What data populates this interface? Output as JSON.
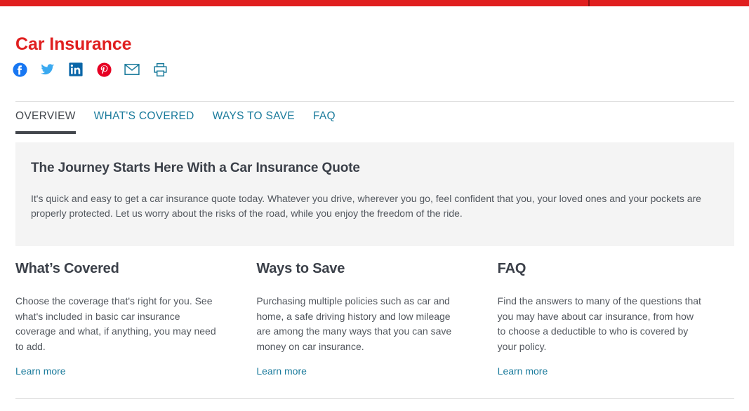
{
  "topbar": {
    "color": "#e01f1f",
    "divider_color": "#8c1212"
  },
  "header": {
    "title": "Car Insurance",
    "title_color": "#e01f1f"
  },
  "share": {
    "items": [
      {
        "name": "facebook-icon",
        "label": "Facebook",
        "color": "#1877f2"
      },
      {
        "name": "twitter-icon",
        "label": "Twitter",
        "color": "#3aa9f0"
      },
      {
        "name": "linkedin-icon",
        "label": "LinkedIn",
        "color": "#0a66a8"
      },
      {
        "name": "pinterest-icon",
        "label": "Pinterest",
        "color": "#e60023"
      },
      {
        "name": "email-icon",
        "label": "Email",
        "color": "#1b7b9c"
      },
      {
        "name": "print-icon",
        "label": "Print",
        "color": "#1b7b9c"
      }
    ]
  },
  "tabs": {
    "active_index": 0,
    "active_color": "#43474d",
    "link_color": "#1b7b9c",
    "items": [
      {
        "label": "OVERVIEW"
      },
      {
        "label": "WHAT'S COVERED"
      },
      {
        "label": "WAYS TO SAVE"
      },
      {
        "label": "FAQ"
      }
    ]
  },
  "hero": {
    "background": "#f4f4f4",
    "title": "The Journey Starts Here With a Car Insurance Quote",
    "body": "It's quick and easy to get a car insurance quote today. Whatever you drive, wherever you go, feel confident that you, your loved ones and your pockets are properly protected. Let us worry about the risks of the road, while you enjoy the freedom of the ride."
  },
  "columns": [
    {
      "title": "What’s Covered",
      "body": "Choose the coverage that's right for you. See what's included in basic car insurance coverage and what, if anything, you may need to add.",
      "link": "Learn more"
    },
    {
      "title": "Ways to Save",
      "body": "Purchasing multiple policies such as car and home, a safe driving history and low mileage are among the many ways that you can save money on car insurance.",
      "link": "Learn more"
    },
    {
      "title": "FAQ",
      "body": "Find the answers to many of the questions that you may have about car insurance, from how to choose a deductible to who is covered by your policy.",
      "link": "Learn more"
    }
  ]
}
